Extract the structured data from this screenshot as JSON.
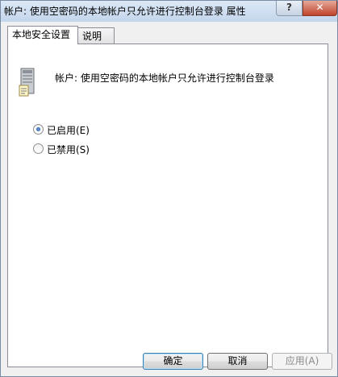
{
  "window": {
    "title": "帐户: 使用空密码的本地帐户只允许进行控制台登录 属性",
    "help_glyph": "?",
    "close_glyph": "✕"
  },
  "tabs": [
    {
      "label": "本地安全设置",
      "active": true
    },
    {
      "label": "说明",
      "active": false
    }
  ],
  "policy": {
    "icon": "server-policy-icon",
    "name": "帐户: 使用空密码的本地帐户只允许进行控制台登录"
  },
  "options": [
    {
      "label": "已启用(E)",
      "checked": true
    },
    {
      "label": "已禁用(S)",
      "checked": false
    }
  ],
  "buttons": {
    "ok": "确定",
    "cancel": "取消",
    "apply": "应用(A)"
  },
  "colors": {
    "accent_radio": "#1b4f9e",
    "default_button_border": "#3c7fb1"
  }
}
